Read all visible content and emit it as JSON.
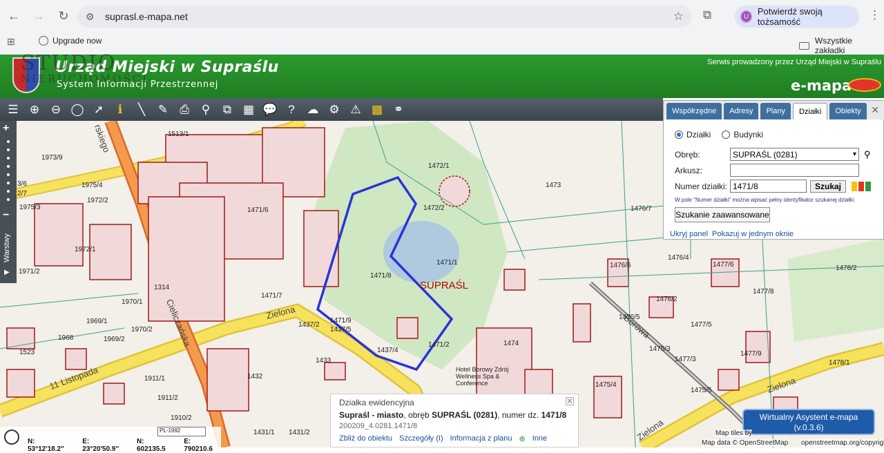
{
  "browser": {
    "url": "suprasl.e-mapa.net",
    "profile_label": "Potwierdź swoją tożsamość",
    "profile_initial": "U",
    "bookmark_upgrade": "Upgrade now",
    "all_bookmarks": "Wszystkie zakładki"
  },
  "header": {
    "title": "Urząd Miejski w Supraślu",
    "subtitle": "System Informacji Przestrzennej",
    "service_text": "Serwis prowadzony przez Urząd Miejski w Supraślu",
    "brand": "e-mapa",
    "watermark_big": "STUDIO",
    "watermark_small": "NIERUCHOMOŚCI"
  },
  "toolbar": {
    "icons": [
      "layers-icon",
      "zoom-in-icon",
      "zoom-out-icon",
      "zoom-extent-icon",
      "select-icon",
      "info-icon",
      "measure-icon",
      "measure-area-icon",
      "print-icon",
      "locate-icon",
      "export-icon",
      "layout-icon",
      "comment-icon",
      "help-icon",
      "download-icon",
      "settings-icon",
      "warning-icon",
      "color-grid-icon",
      "share-icon"
    ]
  },
  "sidebar": {
    "layers_label": "Warstwy"
  },
  "search_panel": {
    "tabs": [
      "Współrzędne",
      "Adresy",
      "Plany",
      "Działki",
      "Obiekty"
    ],
    "active_tab": "Działki",
    "radio_dzialki": "Działki",
    "radio_budynki": "Budynki",
    "obreb_label": "Obręb:",
    "obreb_value": "SUPRAŚL (0281)",
    "arkusz_label": "Arkusz:",
    "arkusz_value": "",
    "numer_label": "Numer działki:",
    "numer_value": "1471/8",
    "search_button": "Szukaj",
    "hint": "W pole \"Numer działki\" można wpisać pełny identyfikator szukanej działki.",
    "advanced_button": "Szukanie zaawansowane",
    "hide_panel": "Ukryj panel",
    "show_one_window": "Pokazuj w jednym oknie",
    "swatch_colors": [
      "#f3c20f",
      "#e43224",
      "#2e9b3a"
    ]
  },
  "map": {
    "town_label": "SUPRAŚL",
    "streets": [
      "Zielona",
      "Cieliczańska",
      "11 Listopada",
      "Borowa",
      "Zielona",
      "Zielona"
    ],
    "street_partial": "rskiego",
    "parcels": [
      "1513/1",
      "1973/9",
      "1975/4",
      "3/6",
      "2/7",
      "1975/3",
      "1972/2",
      "1972/1",
      "1971/2",
      "1314",
      "1970/1",
      "1969/1",
      "1968",
      "1969/2",
      "1970/2",
      "1523",
      "1911/1",
      "1911/2",
      "1910/2",
      "1471/6",
      "1471/7",
      "1471/9",
      "1437/2",
      "1437/5",
      "1437/4",
      "1433",
      "1432",
      "1431/1",
      "1431/2",
      "1472/1",
      "1472/2",
      "1471/8",
      "1471/1",
      "1471/2",
      "1473",
      "1474",
      "1476/7",
      "1476/4",
      "1476/6",
      "1476/5",
      "1476/2",
      "1477/6",
      "1477/5",
      "1475/3",
      "1477/3",
      "1477/9",
      "1477/8",
      "1478/2",
      "1478/1",
      "1475/4",
      "1475/5"
    ],
    "hotel_label": "Hotel Borowy Zdrój Wellness Spa & Conference"
  },
  "popup": {
    "title": "Działka ewidencyjna",
    "line_main_bold": "Supraśl - miasto",
    "line_main_rest": ", obręb ",
    "obreb_bold": "SUPRAŚL (0281)",
    "numer_text": ", numer dz. ",
    "numer_bold": "1471/8",
    "identifier": "200209_4.0281.1471/8",
    "links": [
      "Zbliż do obiektu",
      "Szczegóły (I)",
      "Informacja z planu",
      "Inne"
    ]
  },
  "assistant": {
    "line1": "Wirtualny Asystent e-mapa",
    "line2": "(v.0.3.6)"
  },
  "attribution": {
    "line1": "Map tiles by",
    "line2": "Map data © OpenStreetMap",
    "line3": "openstreetmap.org/copyright"
  },
  "status": {
    "projection": "PL-1992",
    "lat": "N: 53°12'18.2\"",
    "lon": "E: 23°20'50.9\"",
    "n_coord": "N: 602135.5",
    "e_coord": "E: 790210.6"
  }
}
